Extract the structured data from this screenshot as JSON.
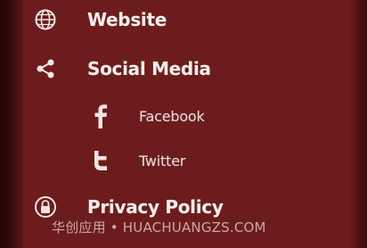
{
  "menu": {
    "items": [
      {
        "label": "Website",
        "icon": "globe-icon"
      },
      {
        "label": "Social Media",
        "icon": "share-icon"
      },
      {
        "label": "Facebook",
        "icon": "facebook-icon"
      },
      {
        "label": "Twitter",
        "icon": "twitter-icon"
      },
      {
        "label": "Privacy Policy",
        "icon": "lock-icon"
      }
    ]
  },
  "watermark": {
    "text": "华创应用 • HUACHUANGZS.COM"
  },
  "colors": {
    "panel": "#6c1c1c",
    "text": "#f4eded",
    "subtext": "#e8dada"
  }
}
